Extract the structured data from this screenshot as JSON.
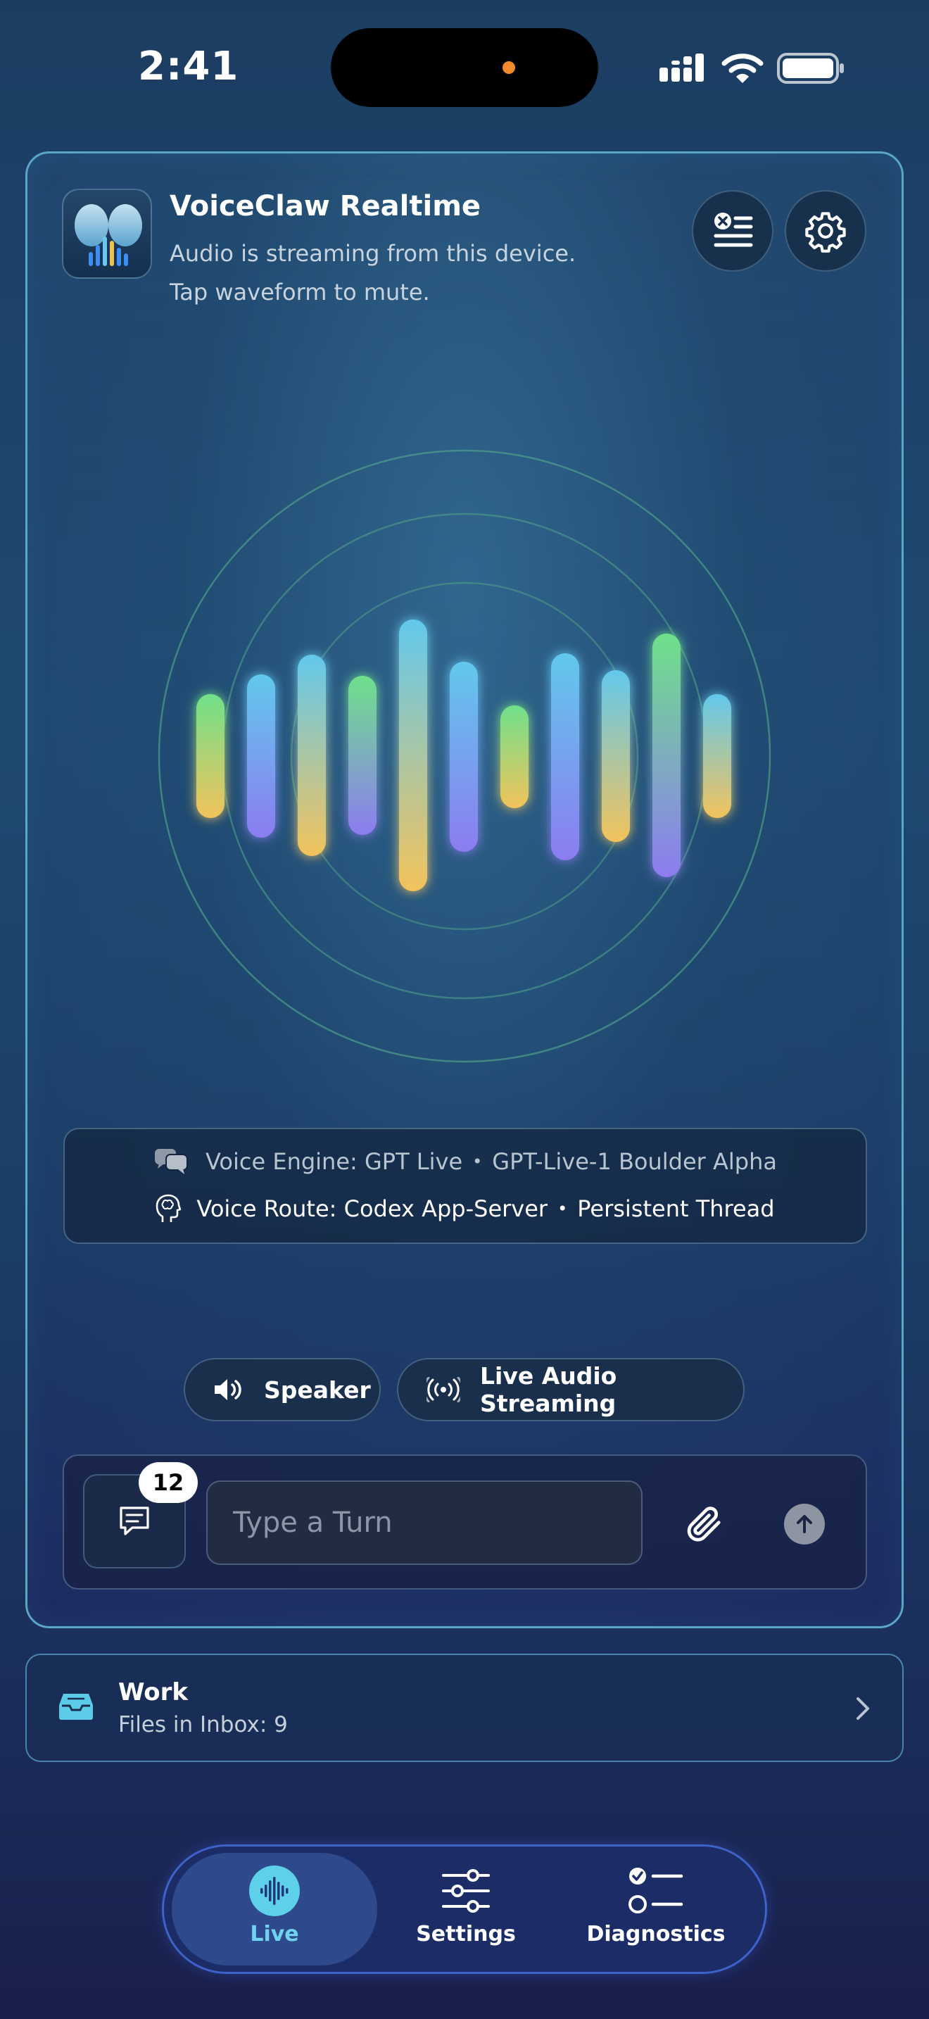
{
  "status_bar": {
    "time": "2:41"
  },
  "header": {
    "title": "VoiceClaw Realtime",
    "subtitle_line1": "Audio is streaming from this device.",
    "subtitle_line2": "Tap waveform to mute.",
    "logo_icon": "voiceclaw-logo-icon",
    "clear_icon": "clear-list-icon",
    "settings_icon": "gear-icon"
  },
  "info": {
    "engine_label": "Voice Engine: GPT Live",
    "engine_model": "GPT-Live-1 Boulder Alpha",
    "route_label": "Voice Route: Codex App-Server",
    "route_thread": "Persistent Thread",
    "separator": "•"
  },
  "pills": {
    "speaker": "Speaker",
    "streaming": "Live Audio Streaming"
  },
  "composer": {
    "unread_count": "12",
    "placeholder": "Type a Turn"
  },
  "inbox": {
    "title": "Work",
    "subtitle": "Files in Inbox: 9"
  },
  "tabs": [
    {
      "label": "Live",
      "icon": "waveform-icon",
      "active": true
    },
    {
      "label": "Settings",
      "icon": "sliders-icon",
      "active": false
    },
    {
      "label": "Diagnostics",
      "icon": "checklist-icon",
      "active": false
    }
  ],
  "colors": {
    "accent": "#5fd0ea",
    "card_border": "#5aa6c7",
    "tabbar_border": "#3e62c8",
    "island_dot": "#f08a2a"
  }
}
